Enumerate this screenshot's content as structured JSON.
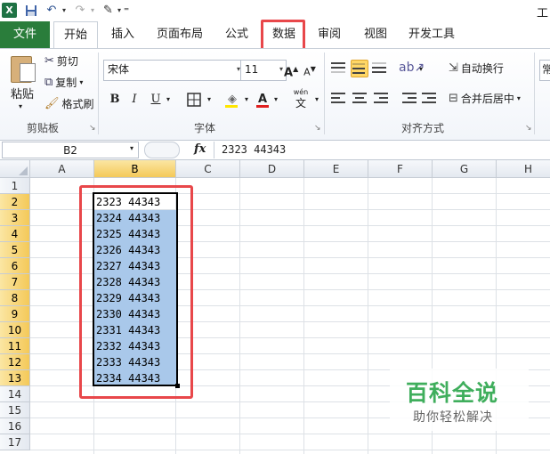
{
  "quick_access": {
    "app_icon": "excel-icon",
    "title_fragment": "工"
  },
  "tabs": {
    "file": "文件",
    "home": "开始",
    "insert": "插入",
    "page_layout": "页面布局",
    "formulas": "公式",
    "data": "数据",
    "review": "审阅",
    "view": "视图",
    "developer": "开发工具"
  },
  "ribbon": {
    "clipboard": {
      "paste": "粘贴",
      "cut": "剪切",
      "copy": "复制",
      "format_painter": "格式刷",
      "group_label": "剪贴板"
    },
    "font": {
      "font_name": "宋体",
      "font_size": "11",
      "bold": "B",
      "italic": "I",
      "underline": "U",
      "grow": "A",
      "shrink": "A",
      "font_color_letter": "A",
      "phonetic": "wén",
      "phonetic_char": "文",
      "group_label": "字体"
    },
    "alignment": {
      "wrap_text": "自动换行",
      "merge_center": "合并后居中",
      "group_label": "对齐方式",
      "clipped_next": "常"
    }
  },
  "formula_bar": {
    "name_box": "B2",
    "fx": "fx",
    "formula": "2323 44343"
  },
  "grid": {
    "columns": [
      "A",
      "B",
      "C",
      "D",
      "E",
      "F",
      "G",
      "H"
    ],
    "rows": [
      "1",
      "2",
      "3",
      "4",
      "5",
      "6",
      "7",
      "8",
      "9",
      "10",
      "11",
      "12",
      "13",
      "14",
      "15",
      "16",
      "17"
    ],
    "cells_B": [
      "2323 44343",
      "2324 44343",
      "2325 44343",
      "2326 44343",
      "2327 44343",
      "2328 44343",
      "2329 44343",
      "2330 44343",
      "2331 44343",
      "2332 44343",
      "2333 44343",
      "2334 44343"
    ]
  },
  "watermark": {
    "title": "百科全说",
    "subtitle": "助你轻松解决"
  },
  "colors": {
    "file_tab": "#2a7d3b",
    "annotation": "#e8474a",
    "selection_fill": "#a9c8ea",
    "watermark_green": "#3fae5c"
  }
}
